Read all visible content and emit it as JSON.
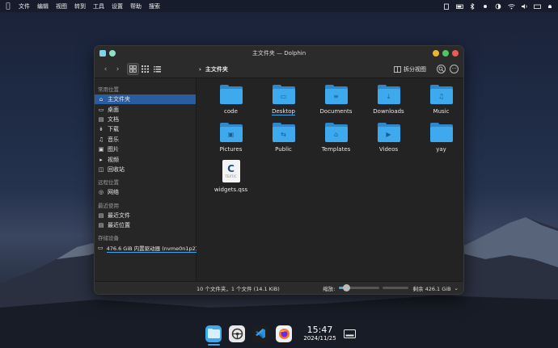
{
  "colors": {
    "accent": "#3fa9ee",
    "selection": "#2a5d9f",
    "window_bg": "#242424"
  },
  "menubar": {
    "apple_icon": "apple-icon",
    "items": [
      "文件",
      "编辑",
      "视图",
      "转到",
      "工具",
      "设置",
      "帮助",
      "搜索"
    ],
    "tray_icons": [
      "clipboard-icon",
      "battery-icon",
      "bluetooth-icon",
      "brightness-icon",
      "night-mode-icon",
      "wifi-icon",
      "volume-icon",
      "keyboard-icon",
      "notifications-icon"
    ]
  },
  "window": {
    "title": "主文件夹 — Dolphin",
    "toolbar": {
      "breadcrumb": "主文件夹",
      "split_label": "拆分视图",
      "more_label": "···"
    },
    "sidebar": {
      "sections": [
        {
          "heading": "常用位置",
          "items": [
            {
              "label": "主文件夹",
              "icon": "home-icon",
              "selected": true
            },
            {
              "label": "桌面",
              "icon": "desktop-icon"
            },
            {
              "label": "文档",
              "icon": "document-icon"
            },
            {
              "label": "下载",
              "icon": "download-icon"
            },
            {
              "label": "音乐",
              "icon": "music-icon"
            },
            {
              "label": "图片",
              "icon": "image-icon"
            },
            {
              "label": "视频",
              "icon": "video-icon"
            },
            {
              "label": "回收站",
              "icon": "trash-icon"
            }
          ]
        },
        {
          "heading": "远程位置",
          "items": [
            {
              "label": "网络",
              "icon": "network-icon"
            }
          ]
        },
        {
          "heading": "最近使用",
          "items": [
            {
              "label": "最近文件",
              "icon": "recent-files-icon"
            },
            {
              "label": "最近位置",
              "icon": "recent-locations-icon"
            }
          ]
        },
        {
          "heading": "存储设备",
          "items": [
            {
              "label": "476.6 GiB 内置驱动器 (nvme0n1p2)",
              "icon": "drive-icon"
            }
          ]
        }
      ]
    },
    "files": [
      {
        "name": "code",
        "type": "folder",
        "glyph": ""
      },
      {
        "name": "Desktop",
        "type": "folder",
        "glyph": "▭",
        "underline": true
      },
      {
        "name": "Documents",
        "type": "folder",
        "glyph": "≡"
      },
      {
        "name": "Downloads",
        "type": "folder",
        "glyph": "⤓"
      },
      {
        "name": "Music",
        "type": "folder",
        "glyph": "♫"
      },
      {
        "name": "Pictures",
        "type": "folder",
        "glyph": "▣"
      },
      {
        "name": "Public",
        "type": "folder",
        "glyph": "⇆"
      },
      {
        "name": "Templates",
        "type": "folder",
        "glyph": "⌂"
      },
      {
        "name": "Videos",
        "type": "folder",
        "glyph": "▶"
      },
      {
        "name": "yay",
        "type": "folder",
        "glyph": ""
      },
      {
        "name": "widgets.qss",
        "type": "file",
        "badge": "C",
        "sub": "TEXT/C"
      }
    ],
    "status": {
      "summary": "10 个文件夹，1 个文件 (14.1 KiB)",
      "zoom_label": "缩放:",
      "zoom_level": 0.2,
      "free_space": "剩余 426.1 GiB"
    }
  },
  "dock": {
    "apps": [
      "dolphin-files-icon",
      "steering-app-icon",
      "vscode-icon",
      "firefox-icon",
      "show-desktop-icon"
    ],
    "time": "15:47",
    "date": "2024/11/25"
  }
}
